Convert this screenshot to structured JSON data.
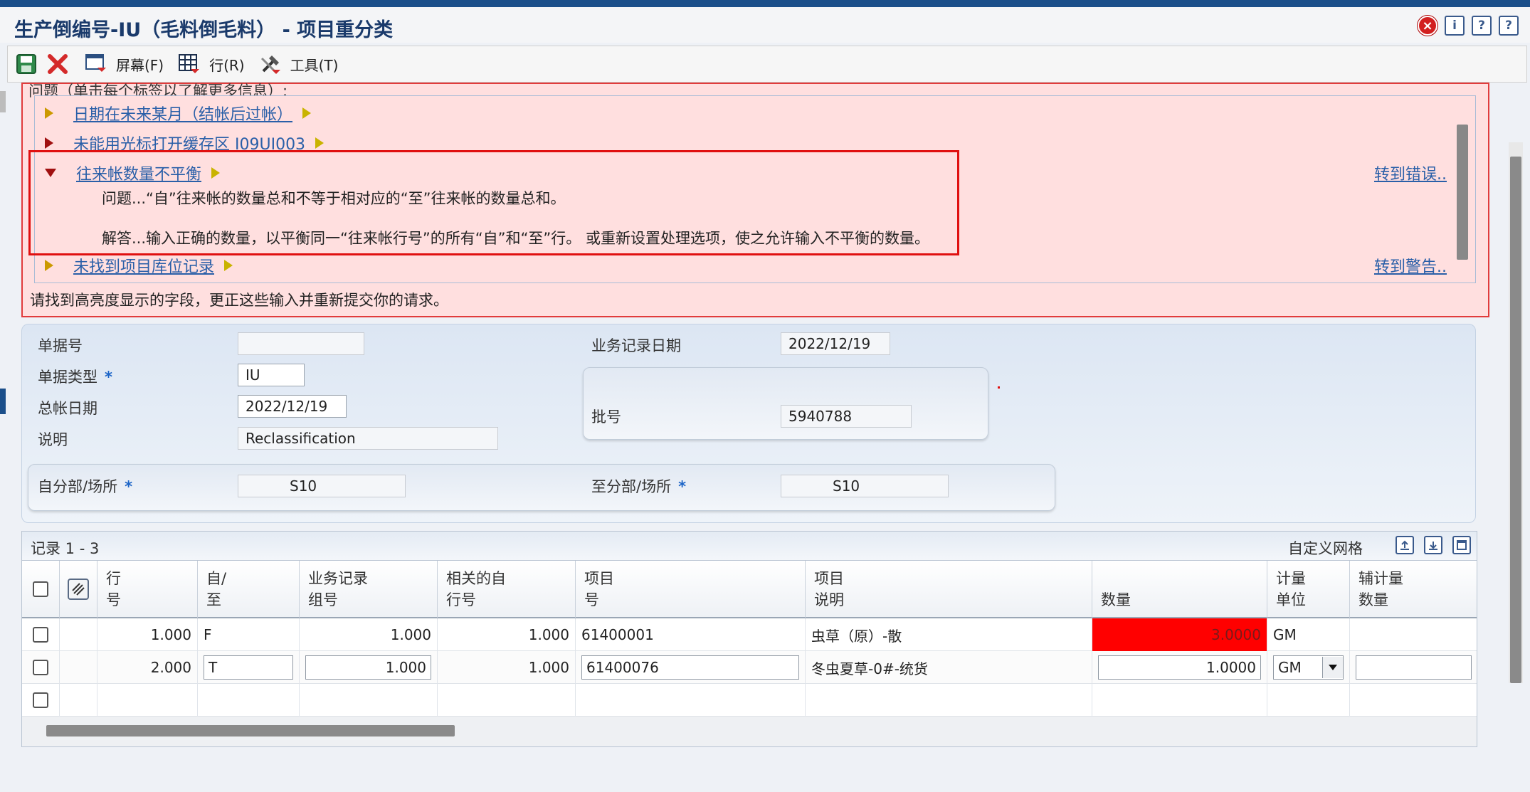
{
  "window": {
    "title": "生产倒编号-IU（毛料倒毛料） - 项目重分类",
    "buttons": {
      "close": "×",
      "info": "i",
      "help": "?",
      "context_help": "?"
    }
  },
  "toolbar": {
    "screen_label": "屏幕(F)",
    "row_label": "行(R)",
    "tools_label": "工具(T)"
  },
  "errors": {
    "header": "问题（单击每个标签以了解更多信息）:",
    "items": [
      {
        "label": "日期在未来某月（结帐后过帐）"
      },
      {
        "label": "未能用光标打开缓存区 I09UI003"
      },
      {
        "label": "往来帐数量不平衡",
        "problem": "问题...“自”往来帐的数量总和不等于相对应的“至”往来帐的数量总和。",
        "solution": "解答...输入正确的数量，以平衡同一“往来帐行号”的所有“自”和“至”行。 或重新设置处理选项，使之允许输入不平衡的数量。"
      },
      {
        "label": "未找到项目库位记录"
      }
    ],
    "goto_error": "转到错误..",
    "goto_warning": "转到警告..",
    "footer": "请找到高亮度显示的字段，更正这些输入并重新提交你的请求。"
  },
  "form": {
    "doc_no_label": "单据号",
    "doc_no_value": "",
    "doc_type_label": "单据类型",
    "doc_type_value": "IU",
    "gl_date_label": "总帐日期",
    "gl_date_value": "2022/12/19",
    "desc_label": "说明",
    "desc_value": "Reclassification",
    "trans_date_label": "业务记录日期",
    "trans_date_value": "2022/12/19",
    "batch_label": "批号",
    "batch_value": "5940788",
    "from_branch_label": "自分部/场所",
    "from_branch_value": "S10",
    "to_branch_label": "至分部/场所",
    "to_branch_value": "S10",
    "required_mark": "*"
  },
  "grid": {
    "records": "记录 1 - 3",
    "custom_grid": "自定义网格",
    "columns": [
      {
        "l1": "行",
        "l2": "号"
      },
      {
        "l1": "自/",
        "l2": "至"
      },
      {
        "l1": "业务记录",
        "l2": "组号"
      },
      {
        "l1": "相关的自",
        "l2": "行号"
      },
      {
        "l1": "项目",
        "l2": "号"
      },
      {
        "l1": "项目",
        "l2": "说明"
      },
      {
        "l1": "",
        "l2": "数量"
      },
      {
        "l1": "计量",
        "l2": "单位"
      },
      {
        "l1": "辅计量",
        "l2": "数量"
      }
    ],
    "rows": [
      {
        "line": "1.000",
        "from_to": "F",
        "group": "1.000",
        "rel_line": "1.000",
        "item": "61400001",
        "desc": "虫草（原）-散",
        "qty": "3.0000",
        "uom": "GM",
        "sec_qty": ""
      },
      {
        "line": "2.000",
        "from_to": "T",
        "group": "1.000",
        "rel_line": "1.000",
        "item": "61400076",
        "desc": "冬虫夏草-0#-统货",
        "qty": "1.0000",
        "uom": "GM",
        "sec_qty": ""
      }
    ]
  },
  "colors": {
    "error_bg": "#ffdfdf",
    "error_border": "#e23b3b",
    "highlight": "#ff0000",
    "link": "#2a5fa8"
  }
}
